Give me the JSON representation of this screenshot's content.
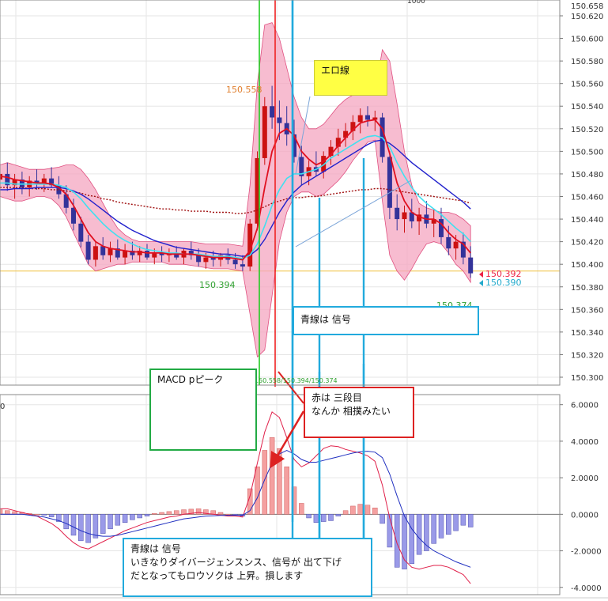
{
  "top_bar": {
    "partial_time_label": "1000",
    "partial_price_label": "150.658"
  },
  "price_chart": {
    "type": "candlestick",
    "y_ticks": [
      "150.620",
      "150.600",
      "150.580",
      "150.560",
      "150.540",
      "150.520",
      "150.500",
      "150.480",
      "150.460",
      "150.440",
      "150.420",
      "150.400",
      "150.380",
      "150.360",
      "150.340",
      "150.320",
      "150.300"
    ],
    "ylim": [
      150.293,
      150.634
    ],
    "reference_price": 150.394,
    "last_price_red": "150.392",
    "last_price_cyan": "150.390",
    "label_high": "150.558",
    "label_low": "150.394",
    "label_low2": "150.374",
    "green_text_strip": "150.558/150.394/150.374"
  },
  "macd_chart": {
    "type": "histogram+line",
    "y_ticks": [
      "6.0000",
      "4.0000",
      "2.0000",
      "0.0000",
      "-2.0000",
      "-4.0000"
    ],
    "ylim": [
      -4.0,
      6.0
    ],
    "panel_label": "0"
  },
  "annotations": {
    "yellow_note": "エロ線",
    "green_note": "MACD pピーク",
    "red_note_line1": "赤は 三段目",
    "red_note_line2": "なんか 相撲みたい",
    "cyan_note_top": "青線は 信号",
    "cyan_note_bottom_line1": "青線は 信号",
    "cyan_note_bottom_line2": "いきなりダイバージェンスンス、信号が 出て下げ",
    "cyan_note_bottom_line3": "だとなってもロウソクは 上昇。損します"
  },
  "colors": {
    "bull": "#cc1111",
    "bear": "#33339a",
    "band_fill": "#f4a6c0",
    "band_line": "#e05080",
    "ma_red": "#e01020",
    "ma_cyan": "#40e0f0",
    "ma_blue": "#2020cc",
    "ma_dotted": "#a01010",
    "hist_pos": "#f4a0a0",
    "hist_neg": "#9a9ae8",
    "green_line": "#22cc22",
    "red_line": "#ee2222",
    "cyan_line": "#22aadd",
    "ref_line": "#f0c040"
  },
  "chart_data": {
    "candles": [
      [
        150.475,
        150.485,
        150.465,
        150.48
      ],
      [
        150.48,
        150.49,
        150.465,
        150.47
      ],
      [
        150.47,
        150.48,
        150.458,
        150.475
      ],
      [
        150.475,
        150.482,
        150.462,
        150.468
      ],
      [
        150.468,
        150.478,
        150.46,
        150.474
      ],
      [
        150.474,
        150.484,
        150.466,
        150.472
      ],
      [
        150.472,
        150.48,
        150.464,
        150.476
      ],
      [
        150.476,
        150.486,
        150.468,
        150.47
      ],
      [
        150.47,
        150.478,
        150.458,
        150.462
      ],
      [
        150.462,
        150.47,
        150.445,
        150.45
      ],
      [
        150.45,
        150.458,
        150.43,
        150.436
      ],
      [
        150.436,
        150.442,
        150.415,
        150.42
      ],
      [
        150.42,
        150.426,
        150.4,
        150.404
      ],
      [
        150.404,
        150.42,
        150.398,
        150.416
      ],
      [
        150.416,
        150.424,
        150.404,
        150.408
      ],
      [
        150.408,
        150.42,
        150.402,
        150.414
      ],
      [
        150.414,
        150.422,
        150.404,
        150.406
      ],
      [
        150.406,
        150.418,
        150.4,
        150.412
      ],
      [
        150.412,
        150.42,
        150.404,
        150.408
      ],
      [
        150.408,
        150.416,
        150.402,
        150.412
      ],
      [
        150.412,
        150.418,
        150.404,
        150.406
      ],
      [
        150.406,
        150.414,
        150.4,
        150.41
      ],
      [
        150.41,
        150.416,
        150.402,
        150.408
      ],
      [
        150.408,
        150.414,
        150.402,
        150.41
      ],
      [
        150.41,
        150.416,
        150.404,
        150.406
      ],
      [
        150.406,
        150.414,
        150.4,
        150.412
      ],
      [
        150.412,
        150.42,
        150.404,
        150.408
      ],
      [
        150.408,
        150.414,
        150.398,
        150.402
      ],
      [
        150.402,
        150.41,
        150.396,
        150.406
      ],
      [
        150.406,
        150.412,
        150.398,
        150.404
      ],
      [
        150.404,
        150.41,
        150.398,
        150.408
      ],
      [
        150.408,
        150.414,
        150.4,
        150.404
      ],
      [
        150.404,
        150.41,
        150.396,
        150.4
      ],
      [
        150.4,
        150.408,
        150.394,
        150.398
      ],
      [
        150.398,
        150.44,
        150.394,
        150.436
      ],
      [
        150.436,
        150.5,
        150.43,
        150.494
      ],
      [
        150.494,
        150.548,
        150.488,
        150.54
      ],
      [
        150.54,
        150.558,
        150.52,
        150.53
      ],
      [
        150.53,
        150.545,
        150.51,
        150.525
      ],
      [
        150.525,
        150.54,
        150.505,
        150.515
      ],
      [
        150.515,
        150.528,
        150.49,
        150.495
      ],
      [
        150.495,
        150.505,
        150.47,
        150.478
      ],
      [
        150.478,
        150.492,
        150.47,
        150.486
      ],
      [
        150.486,
        150.5,
        150.478,
        150.482
      ],
      [
        150.482,
        150.5,
        150.476,
        150.496
      ],
      [
        150.496,
        150.51,
        150.488,
        150.504
      ],
      [
        150.504,
        150.52,
        150.496,
        150.512
      ],
      [
        150.512,
        150.525,
        150.504,
        150.518
      ],
      [
        150.518,
        150.532,
        150.51,
        150.526
      ],
      [
        150.526,
        150.538,
        150.516,
        150.532
      ],
      [
        150.532,
        150.54,
        150.522,
        150.528
      ],
      [
        150.528,
        150.536,
        150.518,
        150.53
      ],
      [
        150.53,
        150.534,
        150.49,
        150.495
      ],
      [
        150.495,
        150.5,
        150.44,
        150.45
      ],
      [
        150.45,
        150.462,
        150.43,
        150.44
      ],
      [
        150.44,
        150.452,
        150.428,
        150.446
      ],
      [
        150.446,
        150.458,
        150.432,
        150.438
      ],
      [
        150.438,
        150.45,
        150.426,
        150.444
      ],
      [
        150.444,
        150.456,
        150.432,
        150.436
      ],
      [
        150.436,
        150.448,
        150.424,
        150.44
      ],
      [
        150.44,
        150.45,
        150.418,
        150.424
      ],
      [
        150.424,
        150.434,
        150.408,
        150.414
      ],
      [
        150.414,
        150.426,
        150.404,
        150.42
      ],
      [
        150.42,
        150.428,
        150.4,
        150.406
      ],
      [
        150.406,
        150.416,
        150.388,
        150.392
      ]
    ],
    "ma_red": [
      150.478,
      150.477,
      150.475,
      150.474,
      150.473,
      150.472,
      150.472,
      150.471,
      150.468,
      150.462,
      150.452,
      150.44,
      150.428,
      150.42,
      150.416,
      150.414,
      150.413,
      150.412,
      150.411,
      150.411,
      150.41,
      150.41,
      150.41,
      150.409,
      150.409,
      150.409,
      150.409,
      150.408,
      150.407,
      150.406,
      150.406,
      150.406,
      150.405,
      150.404,
      150.412,
      150.432,
      150.468,
      150.5,
      150.516,
      150.52,
      150.514,
      150.5,
      150.493,
      150.488,
      150.491,
      150.497,
      150.505,
      150.512,
      150.519,
      150.525,
      150.527,
      150.528,
      150.52,
      150.498,
      150.472,
      150.456,
      150.446,
      150.442,
      150.44,
      150.44,
      150.436,
      150.428,
      150.422,
      150.418,
      150.41
    ],
    "ma_cyan": [
      150.472,
      150.472,
      150.471,
      150.471,
      150.471,
      150.471,
      150.471,
      150.471,
      150.47,
      150.468,
      150.464,
      150.458,
      150.45,
      150.443,
      150.436,
      150.43,
      150.425,
      150.421,
      150.418,
      150.415,
      150.413,
      150.412,
      150.411,
      150.41,
      150.41,
      150.409,
      150.409,
      150.409,
      150.408,
      150.407,
      150.407,
      150.407,
      150.406,
      150.405,
      150.408,
      150.418,
      150.434,
      150.452,
      150.466,
      150.476,
      150.48,
      150.48,
      150.482,
      150.484,
      150.488,
      150.494,
      150.498,
      150.502,
      150.506,
      150.51,
      150.513,
      150.514,
      150.512,
      150.504,
      150.49,
      150.478,
      150.468,
      150.46,
      150.454,
      150.449,
      150.444,
      150.438,
      150.432,
      150.427,
      150.42
    ],
    "ma_blue": [
      150.466,
      150.466,
      150.467,
      150.467,
      150.467,
      150.468,
      150.468,
      150.468,
      150.468,
      150.467,
      150.465,
      150.462,
      150.458,
      150.453,
      150.448,
      150.443,
      150.438,
      150.434,
      150.43,
      150.427,
      150.424,
      150.421,
      150.419,
      150.417,
      150.415,
      150.414,
      150.413,
      150.412,
      150.411,
      150.41,
      150.409,
      150.409,
      150.408,
      150.407,
      150.408,
      150.413,
      150.422,
      150.434,
      150.446,
      150.456,
      150.464,
      150.47,
      150.474,
      150.478,
      150.482,
      150.486,
      150.49,
      150.494,
      150.498,
      150.502,
      150.506,
      150.509,
      150.51,
      150.507,
      150.502,
      150.496,
      150.49,
      150.485,
      150.48,
      150.475,
      150.47,
      150.465,
      150.46,
      150.455,
      150.449
    ],
    "ma_dotted": [
      150.468,
      150.468,
      150.468,
      150.468,
      150.467,
      150.467,
      150.467,
      150.466,
      150.466,
      150.465,
      150.464,
      150.463,
      150.461,
      150.46,
      150.458,
      150.457,
      150.455,
      150.454,
      150.453,
      150.452,
      150.451,
      150.45,
      150.449,
      150.449,
      150.448,
      150.448,
      150.447,
      150.447,
      150.447,
      150.446,
      150.446,
      150.446,
      150.445,
      150.445,
      150.446,
      150.448,
      150.451,
      150.454,
      150.456,
      150.458,
      150.459,
      150.459,
      150.46,
      150.46,
      150.461,
      150.462,
      150.463,
      150.464,
      150.465,
      150.466,
      150.466,
      150.467,
      150.467,
      150.466,
      150.465,
      150.464,
      150.463,
      150.462,
      150.461,
      150.46,
      150.459,
      150.458,
      150.457,
      150.456,
      150.454
    ],
    "band_upper": [
      150.488,
      150.49,
      150.488,
      150.486,
      150.484,
      150.484,
      150.484,
      150.485,
      150.486,
      150.488,
      150.488,
      150.484,
      150.476,
      150.466,
      150.454,
      150.442,
      150.432,
      150.426,
      150.422,
      150.42,
      150.42,
      150.42,
      150.42,
      150.42,
      150.42,
      150.42,
      150.42,
      150.419,
      150.418,
      150.418,
      150.418,
      150.418,
      150.417,
      150.416,
      150.47,
      150.56,
      150.612,
      150.614,
      150.6,
      150.574,
      150.548,
      150.53,
      150.52,
      150.52,
      150.524,
      150.532,
      150.54,
      150.546,
      150.55,
      150.552,
      150.552,
      150.552,
      150.59,
      150.58,
      150.542,
      150.5,
      150.47,
      150.454,
      150.45,
      150.448,
      150.446,
      150.446,
      150.444,
      150.44,
      150.434
    ],
    "band_lower": [
      150.46,
      150.458,
      150.456,
      150.456,
      150.458,
      150.46,
      150.46,
      150.458,
      150.452,
      150.442,
      150.428,
      150.414,
      150.4,
      150.394,
      150.396,
      150.398,
      150.4,
      150.4,
      150.402,
      150.402,
      150.402,
      150.402,
      150.402,
      150.4,
      150.4,
      150.4,
      150.399,
      150.398,
      150.397,
      150.396,
      150.396,
      150.396,
      150.395,
      150.394,
      150.356,
      150.318,
      150.324,
      150.372,
      150.42,
      150.446,
      150.46,
      150.464,
      150.464,
      150.46,
      150.462,
      150.468,
      150.474,
      150.482,
      150.492,
      150.5,
      150.508,
      150.51,
      150.456,
      150.408,
      150.394,
      150.386,
      150.396,
      150.408,
      150.418,
      150.42,
      150.418,
      150.41,
      150.4,
      150.394,
      150.384
    ],
    "macd_hist": [
      0.25,
      0.2,
      0.15,
      0.1,
      0.05,
      0.0,
      -0.05,
      -0.15,
      -0.4,
      -0.8,
      -1.15,
      -1.45,
      -1.55,
      -1.3,
      -1.05,
      -0.8,
      -0.6,
      -0.45,
      -0.3,
      -0.2,
      -0.1,
      0.05,
      0.1,
      0.15,
      0.2,
      0.25,
      0.28,
      0.3,
      0.25,
      0.2,
      0.1,
      0.0,
      -0.05,
      -0.1,
      1.4,
      2.6,
      3.5,
      4.2,
      3.6,
      2.6,
      1.5,
      0.6,
      -0.2,
      -0.45,
      -0.4,
      -0.35,
      -0.1,
      0.2,
      0.45,
      0.55,
      0.5,
      0.35,
      -0.5,
      -1.8,
      -2.9,
      -3.0,
      -2.7,
      -2.2,
      -2.0,
      -1.6,
      -1.3,
      -1.1,
      -0.9,
      -0.6,
      -0.7
    ],
    "macd_line": [
      0.3,
      0.3,
      0.2,
      0.1,
      0.0,
      -0.1,
      -0.3,
      -0.5,
      -0.8,
      -1.2,
      -1.55,
      -1.8,
      -1.9,
      -1.7,
      -1.5,
      -1.3,
      -1.1,
      -0.9,
      -0.75,
      -0.6,
      -0.45,
      -0.35,
      -0.25,
      -0.15,
      -0.1,
      0.0,
      0.05,
      0.1,
      0.05,
      0.0,
      -0.05,
      -0.1,
      -0.1,
      -0.15,
      1.0,
      2.8,
      4.5,
      5.6,
      5.3,
      4.2,
      3.0,
      2.6,
      2.8,
      3.2,
      3.6,
      3.75,
      3.7,
      3.55,
      3.45,
      3.35,
      3.2,
      2.9,
      1.6,
      -0.2,
      -1.6,
      -2.5,
      -2.9,
      -3.0,
      -2.9,
      -2.8,
      -2.8,
      -2.9,
      -3.1,
      -3.3,
      -3.8
    ],
    "macd_signal": [
      0.0,
      0.0,
      0.0,
      0.0,
      -0.05,
      -0.1,
      -0.15,
      -0.25,
      -0.35,
      -0.5,
      -0.7,
      -0.9,
      -1.05,
      -1.15,
      -1.2,
      -1.2,
      -1.15,
      -1.05,
      -0.95,
      -0.85,
      -0.75,
      -0.65,
      -0.55,
      -0.45,
      -0.35,
      -0.25,
      -0.2,
      -0.15,
      -0.1,
      -0.08,
      -0.06,
      -0.05,
      -0.05,
      -0.05,
      0.2,
      0.9,
      1.9,
      2.8,
      3.3,
      3.5,
      3.3,
      3.0,
      2.85,
      2.85,
      2.95,
      3.05,
      3.15,
      3.25,
      3.35,
      3.42,
      3.45,
      3.4,
      3.1,
      2.2,
      1.0,
      -0.1,
      -0.8,
      -1.3,
      -1.7,
      -2.0,
      -2.2,
      -2.4,
      -2.6,
      -2.75,
      -2.9
    ]
  }
}
